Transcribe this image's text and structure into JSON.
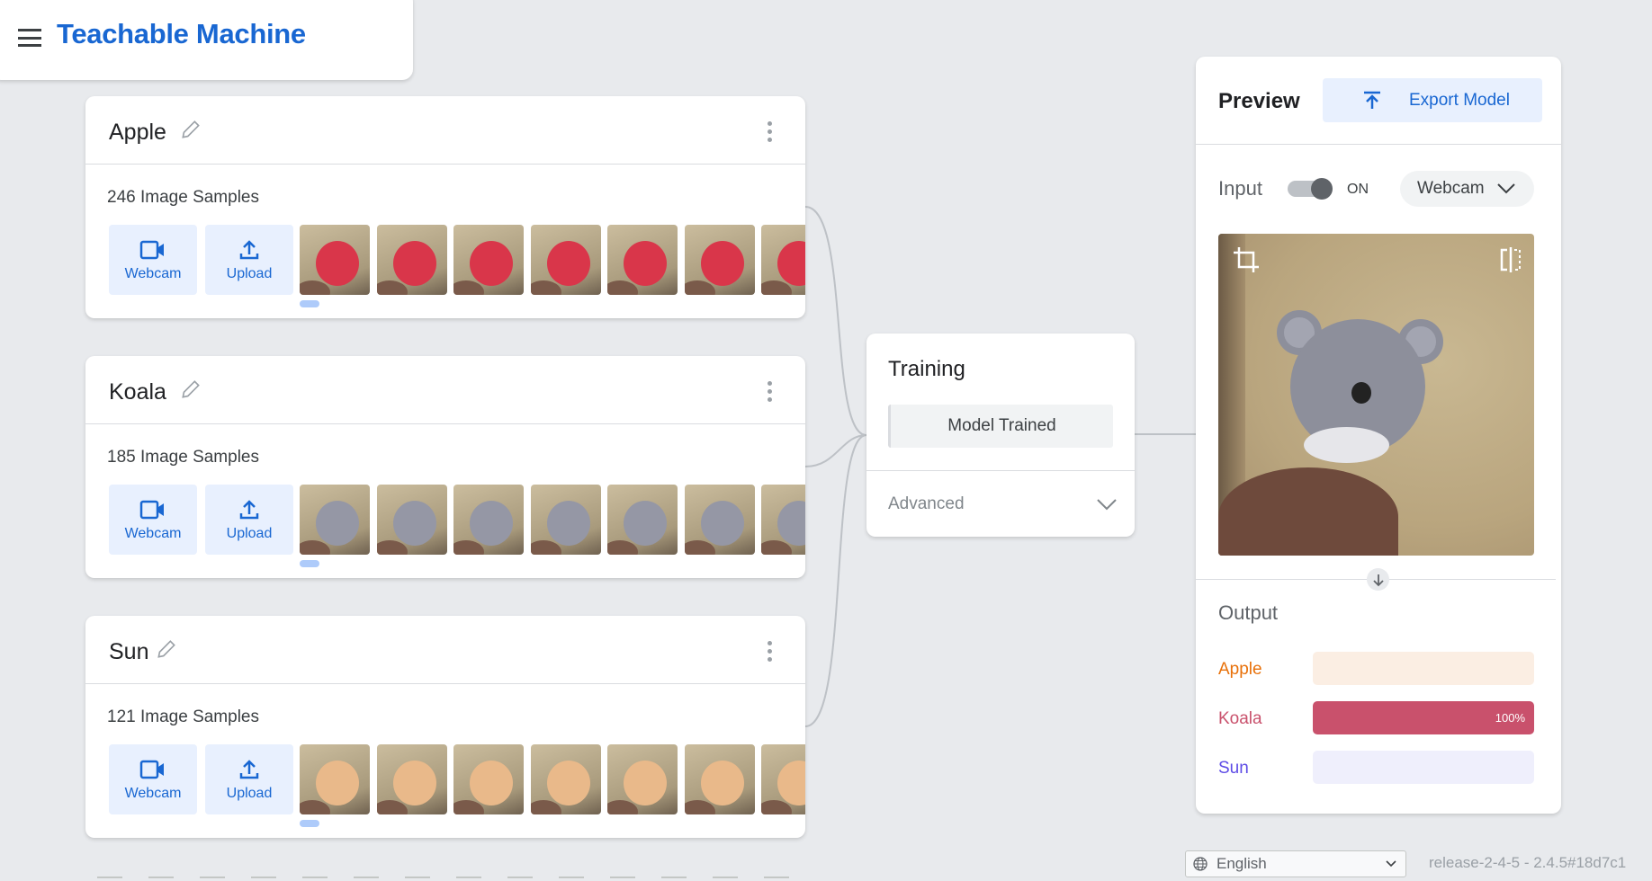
{
  "app": {
    "title": "Teachable Machine"
  },
  "classes": [
    {
      "name": "Apple",
      "samples": "246 Image Samples",
      "webcam": "Webcam",
      "upload": "Upload",
      "obj_color": "#d9364a"
    },
    {
      "name": "Koala",
      "samples": "185 Image Samples",
      "webcam": "Webcam",
      "upload": "Upload",
      "obj_color": "#9597a5"
    },
    {
      "name": "Sun",
      "samples": "121 Image Samples",
      "webcam": "Webcam",
      "upload": "Upload",
      "obj_color": "#e9b98a"
    }
  ],
  "training": {
    "title": "Training",
    "button": "Model Trained",
    "advanced": "Advanced"
  },
  "preview": {
    "title": "Preview",
    "export": "Export Model",
    "input_label": "Input",
    "toggle_state": "ON",
    "source": "Webcam",
    "output_label": "Output",
    "outputs": [
      {
        "label": "Apple",
        "value": 0,
        "pct": "",
        "color": "#e8710a",
        "bg": "#fbeee3"
      },
      {
        "label": "Koala",
        "value": 100,
        "pct": "100%",
        "color": "#c9516c",
        "bg": "#f7dde3"
      },
      {
        "label": "Sun",
        "value": 0,
        "pct": "",
        "color": "#5e4ce6",
        "bg": "#efeffc"
      }
    ]
  },
  "footer": {
    "language": "English",
    "release": "release-2-4-5 - 2.4.5#18d7c1"
  }
}
